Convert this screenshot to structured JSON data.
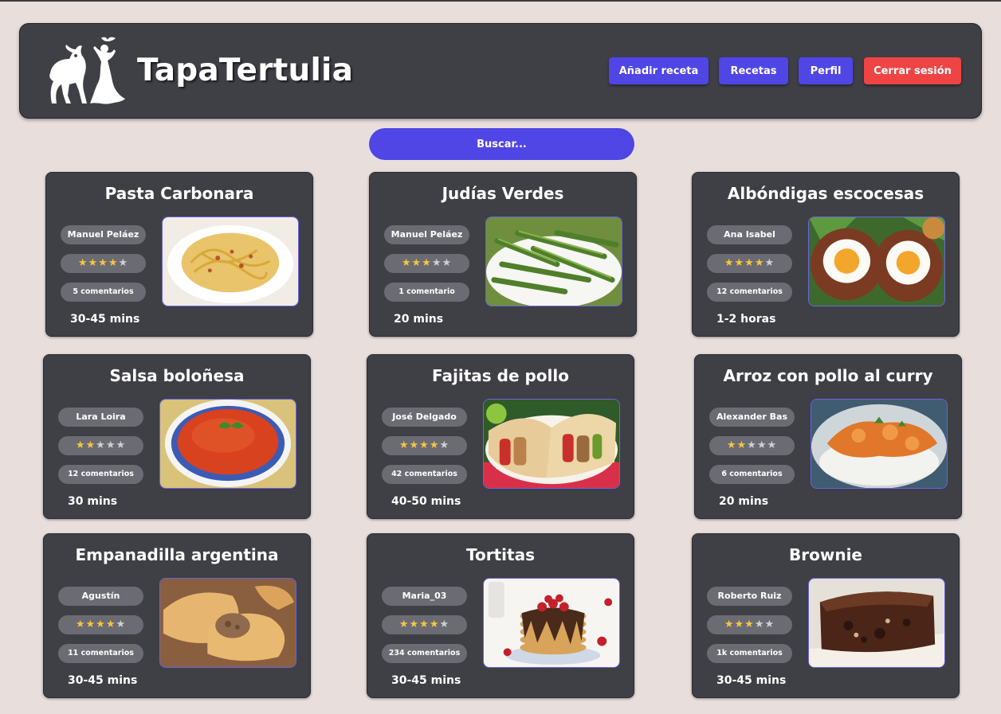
{
  "app": {
    "brand": "TapaTertulia",
    "nav": {
      "add_recipe": "Añadir receta",
      "recipes": "Recetas",
      "profile": "Perfil",
      "logout": "Cerrar sesión"
    },
    "search": {
      "placeholder": "Buscar..."
    }
  },
  "colors": {
    "header_bg": "#3f3f46",
    "page_bg": "#e8dfdd",
    "primary": "#4f46e5",
    "danger": "#ef4444",
    "star": "#f5c542"
  },
  "recipes": [
    {
      "title": "Pasta Carbonara",
      "author": "Manuel Peláez",
      "stars": 4,
      "max_stars": 5,
      "comments": "5 comentarios",
      "time": "30-45 mins",
      "image": "pasta-carbonara-photo"
    },
    {
      "title": "Judías Verdes",
      "author": "Manuel Peláez",
      "stars": 3,
      "max_stars": 5,
      "comments": "1 comentario",
      "time": "20 mins",
      "image": "green-beans-photo"
    },
    {
      "title": "Albóndigas escocesas",
      "author": "Ana Isabel",
      "stars": 4,
      "max_stars": 5,
      "comments": "12 comentarios",
      "time": "1-2 horas",
      "image": "scotch-eggs-photo"
    },
    {
      "title": "Salsa boloñesa",
      "author": "Lara Loira",
      "stars": 2,
      "max_stars": 5,
      "comments": "12 comentarios",
      "time": "30 mins",
      "image": "bolognese-sauce-photo"
    },
    {
      "title": "Fajitas de pollo",
      "author": "José Delgado",
      "stars": 4,
      "max_stars": 5,
      "comments": "42 comentarios",
      "time": "40-50 mins",
      "image": "chicken-fajitas-photo"
    },
    {
      "title": "Arroz con pollo al curry",
      "author": "Alexander Bas",
      "stars": 2,
      "max_stars": 5,
      "comments": "6 comentarios",
      "time": "20 mins",
      "image": "chicken-curry-rice-photo"
    },
    {
      "title": "Empanadilla argentina",
      "author": "Agustín",
      "stars": 4,
      "max_stars": 5,
      "comments": "11 comentarios",
      "time": "30-45 mins",
      "image": "empanadas-photo"
    },
    {
      "title": "Tortitas",
      "author": "Maria_03",
      "stars": 4,
      "max_stars": 5,
      "comments": "234 comentarios",
      "time": "30-45 mins",
      "image": "pancakes-photo"
    },
    {
      "title": "Brownie",
      "author": "Roberto Ruiz",
      "stars": 3,
      "max_stars": 5,
      "comments": "1k comentarios",
      "time": "30-45 mins",
      "image": "brownie-photo"
    }
  ]
}
